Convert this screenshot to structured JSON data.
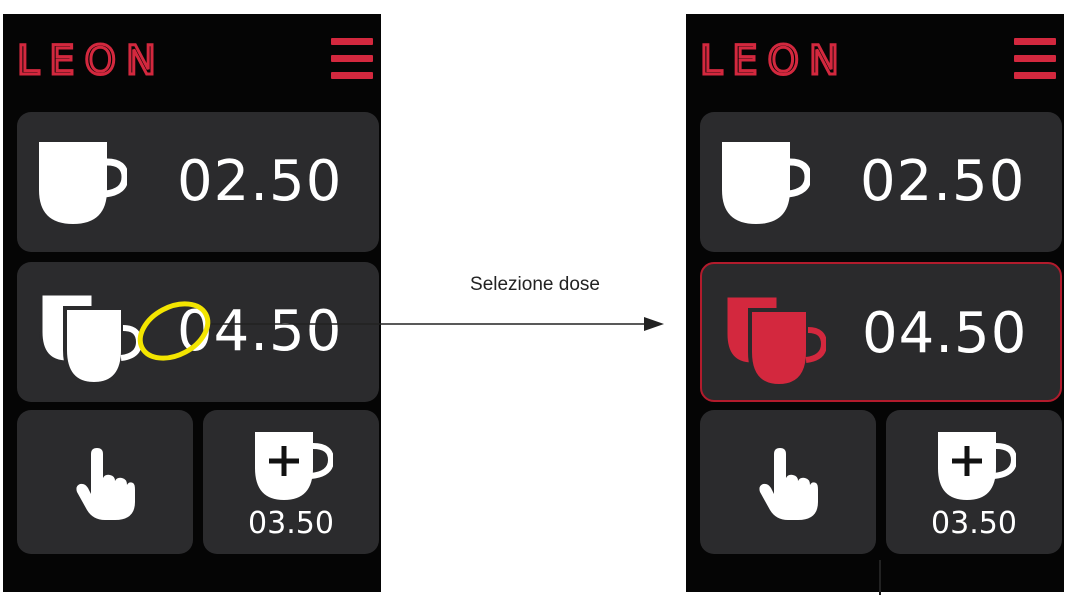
{
  "brand": "LEON",
  "colors": {
    "accent": "#d3283e",
    "panel": "#2b2b2d",
    "screen": "#050505",
    "highlight": "#f3e500"
  },
  "caption": "Selezione dose",
  "screens": {
    "left": {
      "dose1": "02.50",
      "dose2": "04.50",
      "plus_dose": "03.50"
    },
    "right": {
      "dose1": "02.50",
      "dose2": "04.50",
      "plus_dose": "03.50",
      "selected": "dose2"
    }
  },
  "icons": [
    "menu-icon",
    "single-cup-icon",
    "double-cup-icon",
    "hand-pointer-icon",
    "cup-plus-icon"
  ]
}
